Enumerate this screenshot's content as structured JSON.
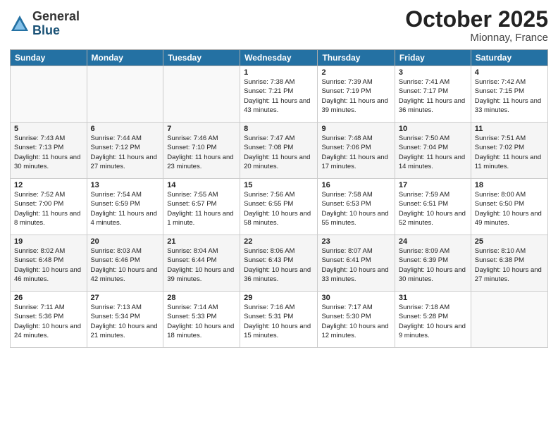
{
  "header": {
    "logo_general": "General",
    "logo_blue": "Blue",
    "month": "October 2025",
    "location": "Mionnay, France"
  },
  "days_of_week": [
    "Sunday",
    "Monday",
    "Tuesday",
    "Wednesday",
    "Thursday",
    "Friday",
    "Saturday"
  ],
  "weeks": [
    [
      {
        "day": "",
        "sunrise": "",
        "sunset": "",
        "daylight": ""
      },
      {
        "day": "",
        "sunrise": "",
        "sunset": "",
        "daylight": ""
      },
      {
        "day": "",
        "sunrise": "",
        "sunset": "",
        "daylight": ""
      },
      {
        "day": "1",
        "sunrise": "Sunrise: 7:38 AM",
        "sunset": "Sunset: 7:21 PM",
        "daylight": "Daylight: 11 hours and 43 minutes."
      },
      {
        "day": "2",
        "sunrise": "Sunrise: 7:39 AM",
        "sunset": "Sunset: 7:19 PM",
        "daylight": "Daylight: 11 hours and 39 minutes."
      },
      {
        "day": "3",
        "sunrise": "Sunrise: 7:41 AM",
        "sunset": "Sunset: 7:17 PM",
        "daylight": "Daylight: 11 hours and 36 minutes."
      },
      {
        "day": "4",
        "sunrise": "Sunrise: 7:42 AM",
        "sunset": "Sunset: 7:15 PM",
        "daylight": "Daylight: 11 hours and 33 minutes."
      }
    ],
    [
      {
        "day": "5",
        "sunrise": "Sunrise: 7:43 AM",
        "sunset": "Sunset: 7:13 PM",
        "daylight": "Daylight: 11 hours and 30 minutes."
      },
      {
        "day": "6",
        "sunrise": "Sunrise: 7:44 AM",
        "sunset": "Sunset: 7:12 PM",
        "daylight": "Daylight: 11 hours and 27 minutes."
      },
      {
        "day": "7",
        "sunrise": "Sunrise: 7:46 AM",
        "sunset": "Sunset: 7:10 PM",
        "daylight": "Daylight: 11 hours and 23 minutes."
      },
      {
        "day": "8",
        "sunrise": "Sunrise: 7:47 AM",
        "sunset": "Sunset: 7:08 PM",
        "daylight": "Daylight: 11 hours and 20 minutes."
      },
      {
        "day": "9",
        "sunrise": "Sunrise: 7:48 AM",
        "sunset": "Sunset: 7:06 PM",
        "daylight": "Daylight: 11 hours and 17 minutes."
      },
      {
        "day": "10",
        "sunrise": "Sunrise: 7:50 AM",
        "sunset": "Sunset: 7:04 PM",
        "daylight": "Daylight: 11 hours and 14 minutes."
      },
      {
        "day": "11",
        "sunrise": "Sunrise: 7:51 AM",
        "sunset": "Sunset: 7:02 PM",
        "daylight": "Daylight: 11 hours and 11 minutes."
      }
    ],
    [
      {
        "day": "12",
        "sunrise": "Sunrise: 7:52 AM",
        "sunset": "Sunset: 7:00 PM",
        "daylight": "Daylight: 11 hours and 8 minutes."
      },
      {
        "day": "13",
        "sunrise": "Sunrise: 7:54 AM",
        "sunset": "Sunset: 6:59 PM",
        "daylight": "Daylight: 11 hours and 4 minutes."
      },
      {
        "day": "14",
        "sunrise": "Sunrise: 7:55 AM",
        "sunset": "Sunset: 6:57 PM",
        "daylight": "Daylight: 11 hours and 1 minute."
      },
      {
        "day": "15",
        "sunrise": "Sunrise: 7:56 AM",
        "sunset": "Sunset: 6:55 PM",
        "daylight": "Daylight: 10 hours and 58 minutes."
      },
      {
        "day": "16",
        "sunrise": "Sunrise: 7:58 AM",
        "sunset": "Sunset: 6:53 PM",
        "daylight": "Daylight: 10 hours and 55 minutes."
      },
      {
        "day": "17",
        "sunrise": "Sunrise: 7:59 AM",
        "sunset": "Sunset: 6:51 PM",
        "daylight": "Daylight: 10 hours and 52 minutes."
      },
      {
        "day": "18",
        "sunrise": "Sunrise: 8:00 AM",
        "sunset": "Sunset: 6:50 PM",
        "daylight": "Daylight: 10 hours and 49 minutes."
      }
    ],
    [
      {
        "day": "19",
        "sunrise": "Sunrise: 8:02 AM",
        "sunset": "Sunset: 6:48 PM",
        "daylight": "Daylight: 10 hours and 46 minutes."
      },
      {
        "day": "20",
        "sunrise": "Sunrise: 8:03 AM",
        "sunset": "Sunset: 6:46 PM",
        "daylight": "Daylight: 10 hours and 42 minutes."
      },
      {
        "day": "21",
        "sunrise": "Sunrise: 8:04 AM",
        "sunset": "Sunset: 6:44 PM",
        "daylight": "Daylight: 10 hours and 39 minutes."
      },
      {
        "day": "22",
        "sunrise": "Sunrise: 8:06 AM",
        "sunset": "Sunset: 6:43 PM",
        "daylight": "Daylight: 10 hours and 36 minutes."
      },
      {
        "day": "23",
        "sunrise": "Sunrise: 8:07 AM",
        "sunset": "Sunset: 6:41 PM",
        "daylight": "Daylight: 10 hours and 33 minutes."
      },
      {
        "day": "24",
        "sunrise": "Sunrise: 8:09 AM",
        "sunset": "Sunset: 6:39 PM",
        "daylight": "Daylight: 10 hours and 30 minutes."
      },
      {
        "day": "25",
        "sunrise": "Sunrise: 8:10 AM",
        "sunset": "Sunset: 6:38 PM",
        "daylight": "Daylight: 10 hours and 27 minutes."
      }
    ],
    [
      {
        "day": "26",
        "sunrise": "Sunrise: 7:11 AM",
        "sunset": "Sunset: 5:36 PM",
        "daylight": "Daylight: 10 hours and 24 minutes."
      },
      {
        "day": "27",
        "sunrise": "Sunrise: 7:13 AM",
        "sunset": "Sunset: 5:34 PM",
        "daylight": "Daylight: 10 hours and 21 minutes."
      },
      {
        "day": "28",
        "sunrise": "Sunrise: 7:14 AM",
        "sunset": "Sunset: 5:33 PM",
        "daylight": "Daylight: 10 hours and 18 minutes."
      },
      {
        "day": "29",
        "sunrise": "Sunrise: 7:16 AM",
        "sunset": "Sunset: 5:31 PM",
        "daylight": "Daylight: 10 hours and 15 minutes."
      },
      {
        "day": "30",
        "sunrise": "Sunrise: 7:17 AM",
        "sunset": "Sunset: 5:30 PM",
        "daylight": "Daylight: 10 hours and 12 minutes."
      },
      {
        "day": "31",
        "sunrise": "Sunrise: 7:18 AM",
        "sunset": "Sunset: 5:28 PM",
        "daylight": "Daylight: 10 hours and 9 minutes."
      },
      {
        "day": "",
        "sunrise": "",
        "sunset": "",
        "daylight": ""
      }
    ]
  ]
}
